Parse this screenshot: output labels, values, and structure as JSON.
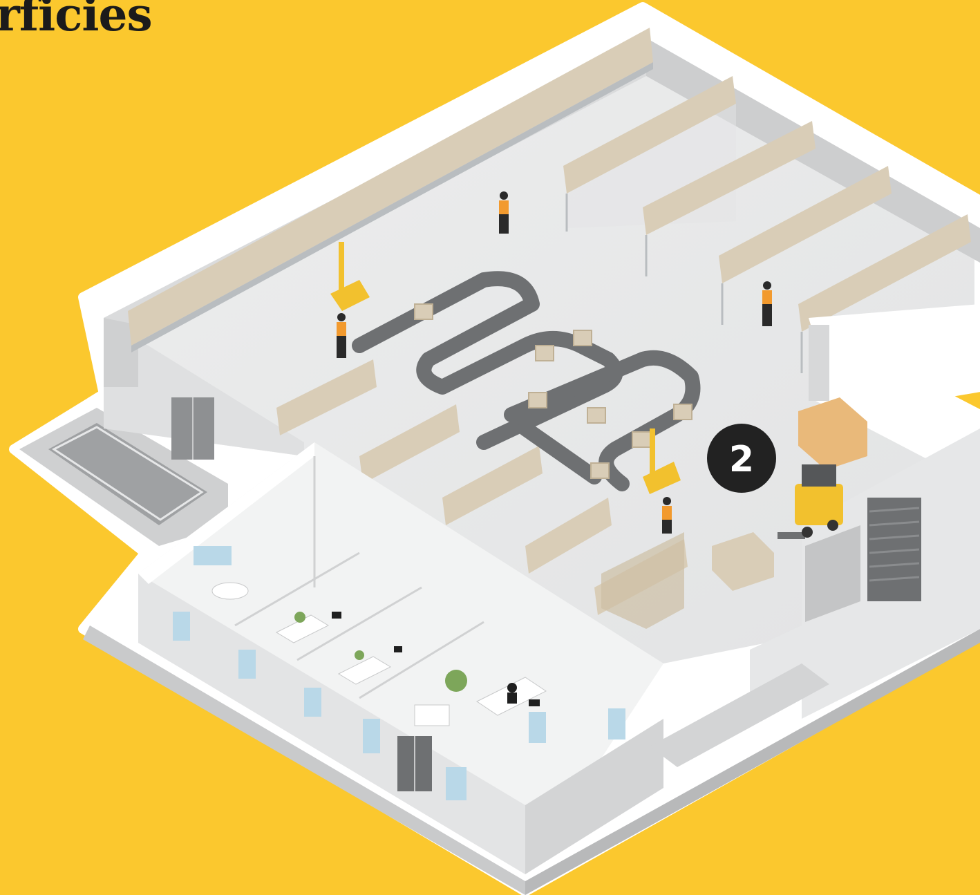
{
  "title": "rficies",
  "marker": {
    "label": "2"
  },
  "colors": {
    "background": "#FBC82E",
    "floor": "#E9EAEA",
    "wall_top": "#FFFFFF",
    "wall_side": "#D5D6D7",
    "shelf_frame": "#B9BDC0",
    "box": "#D9CDB7",
    "box_dark": "#C4B59A",
    "conveyor": "#6E7072",
    "marker_fill": "#222222",
    "forklift": "#F2C12E"
  }
}
